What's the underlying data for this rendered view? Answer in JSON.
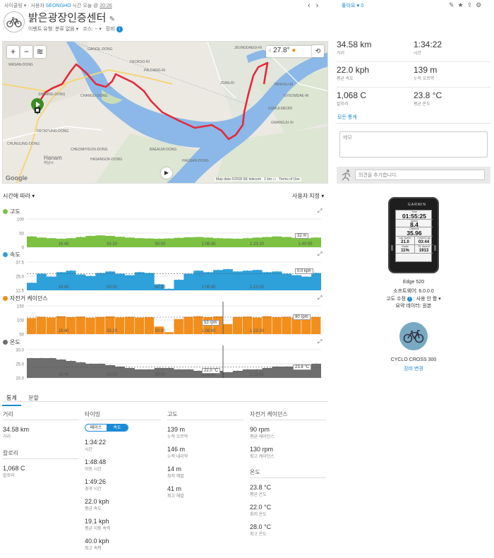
{
  "header": {
    "crumb_activity": "사이클링",
    "crumb_user_label": "사용자",
    "crumb_user": "SEONGHO",
    "crumb_time_label": "시간",
    "crumb_time_date": "오늘 @",
    "crumb_time": "20:26",
    "title": "밝은광장인증센터",
    "event_type": "이벤트 유형: 분류 없음 ▾",
    "course": "코스: -- ▾",
    "gear": "장비",
    "like": "좋아요",
    "like_count": "0"
  },
  "map": {
    "temperature": "27.8°",
    "attribution": "Map data ©2018 SK telecom",
    "scale": "1 km",
    "terms": "Terms of Use",
    "google": "Google",
    "places": [
      "WASAN-DONG",
      "GANGIL-DONG",
      "PALDANG-RI",
      "DEOKSO-RI",
      "JOAN-RI",
      "SINJANG-DONG",
      "CHANGU-DONG",
      "Hanam",
      "하남시",
      "CHUNGUNG-DONG",
      "DEOKPUNG-DONG",
      "CHEONHYEON-DONG",
      "HASANGOK-DONG",
      "BAEALMI-DONG",
      "HAGSAN-DONG",
      "JEUNGDAEGI-RI",
      "YANGSU-RI",
      "GYEOMDAE-RI",
      "DUMULMEORI",
      "GWANGJU-SI"
    ]
  },
  "chart_controls": {
    "left": "시간에 따라 ▾",
    "right": "사용자 지정 ▾"
  },
  "colors": {
    "elevation": "#7cc142",
    "speed": "#2ea0da",
    "cadence": "#f28e1c",
    "temperature": "#6e6e6e",
    "route": "#e4293c",
    "accent": "#1a8bd6"
  },
  "chart_data": [
    {
      "type": "area",
      "title": "고도",
      "color_key": "elevation",
      "ylim": [
        0,
        100
      ],
      "yticks": [
        "100",
        "50",
        "0"
      ],
      "xticks": [
        "16:40",
        "33:20",
        "50:00",
        "1:06:40",
        "1:23:20",
        "1:40:00"
      ],
      "readout": "32 m",
      "x_minutes": [
        0,
        4,
        8,
        12,
        16,
        20,
        24,
        28,
        32,
        36,
        40,
        44,
        48,
        52,
        56,
        60,
        64,
        68,
        72,
        76,
        80,
        84,
        88,
        92,
        96,
        100,
        104,
        108,
        112,
        116
      ],
      "values": [
        38,
        34,
        32,
        30,
        32,
        36,
        40,
        42,
        40,
        37,
        34,
        32,
        31,
        30,
        31,
        33,
        35,
        36,
        34,
        32,
        31,
        30,
        32,
        34,
        36,
        38,
        36,
        33,
        32,
        34
      ]
    },
    {
      "type": "area",
      "title": "속도",
      "color_key": "speed",
      "ylim": [
        0,
        37.5
      ],
      "yticks": [
        "37.5",
        "25.0",
        "12.5"
      ],
      "xticks": [
        "16:40",
        "33:20",
        "50:00",
        "1:06:40",
        "1:23:20"
      ],
      "readout": "0.0 kph",
      "avg_line": 22.0,
      "x_minutes": [
        0,
        4,
        8,
        12,
        16,
        20,
        24,
        28,
        32,
        36,
        40,
        44,
        48,
        52,
        56,
        60,
        64,
        68,
        72,
        76,
        80,
        84,
        88,
        92,
        96,
        100,
        104,
        108,
        112,
        116
      ],
      "values": [
        10,
        22,
        18,
        24,
        26,
        21,
        19,
        23,
        25,
        22,
        20,
        24,
        23,
        8,
        2,
        14,
        22,
        26,
        24,
        27,
        28,
        25,
        26,
        27,
        24,
        25,
        22,
        20,
        18,
        23
      ]
    },
    {
      "type": "bar",
      "title": "자전거 케이던스",
      "color_key": "cadence",
      "ylim": [
        0,
        150
      ],
      "yticks": [
        "150",
        "100",
        "50"
      ],
      "xticks": [
        "16:40",
        "33:20",
        "50:00",
        "1:06:40",
        "1:23:20"
      ],
      "readout": "53 rpm",
      "readout2": "90 rpm",
      "cursor_minute": 80,
      "avg_line": 90,
      "x_minutes": [
        0,
        4,
        8,
        12,
        16,
        20,
        24,
        28,
        32,
        36,
        40,
        44,
        48,
        52,
        56,
        60,
        64,
        68,
        72,
        76,
        80,
        84,
        88,
        92,
        96,
        100,
        104,
        108,
        112,
        116
      ],
      "values": [
        85,
        92,
        88,
        95,
        90,
        93,
        87,
        91,
        94,
        89,
        92,
        88,
        90,
        40,
        10,
        80,
        92,
        95,
        90,
        94,
        53,
        91,
        93,
        88,
        95,
        90,
        92,
        87,
        90,
        91
      ]
    },
    {
      "type": "area",
      "title": "온도",
      "color_key": "temperature",
      "ylim": [
        20.0,
        30.0
      ],
      "yticks": [
        "30.0",
        "25.0",
        "20.0"
      ],
      "xticks": [
        "16:40",
        "33:20",
        "50:00",
        "1:06:40",
        "1:23:20"
      ],
      "readout": "22.0 °C",
      "readout2": "23.8 °C",
      "cursor_minute": 80,
      "avg_line": 23.8,
      "x_minutes": [
        0,
        4,
        8,
        12,
        16,
        20,
        24,
        28,
        32,
        36,
        40,
        44,
        48,
        52,
        56,
        60,
        64,
        68,
        72,
        76,
        80,
        84,
        88,
        92,
        96,
        100,
        104,
        108,
        112,
        116
      ],
      "values": [
        27,
        27,
        27,
        26.5,
        26,
        25.5,
        25,
        25,
        24.5,
        24,
        23.5,
        23,
        23,
        23.5,
        23.5,
        23,
        23,
        22.5,
        22.5,
        22.5,
        22,
        22.5,
        23,
        23,
        23.5,
        24,
        24,
        24,
        24.5,
        25
      ]
    }
  ],
  "tabs": [
    "통계",
    "분할"
  ],
  "stats": {
    "distance": {
      "head": "거리",
      "value": "34.58 km",
      "label": "거리"
    },
    "calories": {
      "head": "칼로리",
      "value": "1,068 C",
      "label": "칼로리"
    },
    "timing": {
      "head": "타이밍",
      "toggle_a": "페이스",
      "toggle_b": "속도",
      "rows": [
        {
          "value": "1:34:22",
          "label": "시간"
        },
        {
          "value": "1:48:48",
          "label": "이동 시간"
        },
        {
          "value": "1:49:26",
          "label": "경과 시간"
        },
        {
          "value": "22.0 kph",
          "label": "평균 속도"
        },
        {
          "value": "19.1 kph",
          "label": "평균 이동 속력"
        },
        {
          "value": "40.0 kph",
          "label": "최고 속력"
        }
      ]
    },
    "elevation": {
      "head": "고도",
      "rows": [
        {
          "value": "139 m",
          "label": "누적 오르막"
        },
        {
          "value": "146 m",
          "label": "누적 내리막"
        },
        {
          "value": "14 m",
          "label": "최저 해발"
        },
        {
          "value": "41 m",
          "label": "최고 해발"
        }
      ]
    },
    "cadence": {
      "head": "자전거 케이던스",
      "rows": [
        {
          "value": "90 rpm",
          "label": "평균 케이던스"
        },
        {
          "value": "130 rpm",
          "label": "최고 케이던스"
        }
      ]
    },
    "temperature": {
      "head": "온도",
      "rows": [
        {
          "value": "23.8 °C",
          "label": "평균 온도"
        },
        {
          "value": "22.0 °C",
          "label": "최저 온도"
        },
        {
          "value": "28.0 °C",
          "label": "최고 온도"
        }
      ]
    }
  },
  "summary": {
    "items": [
      {
        "value": "34.58 km",
        "label": "거리"
      },
      {
        "value": "1:34:22",
        "label": "시간"
      },
      {
        "value": "22.0 kph",
        "label": "평균 속도"
      },
      {
        "value": "139 m",
        "label": "누적 오르막"
      },
      {
        "value": "1,068 C",
        "label": "칼로리"
      },
      {
        "value": "23.8 °C",
        "label": "평균 온도"
      }
    ],
    "all_stats": "모든 통계"
  },
  "notes": {
    "placeholder": "메모"
  },
  "comment": {
    "placeholder": "의견을 추가합니다."
  },
  "device": {
    "brand": "GARMIN",
    "screen": [
      {
        "label": "Time",
        "value": "01:55:25"
      },
      {
        "label": "Speed",
        "value": "8.4"
      },
      {
        "label": "Distance",
        "value": "35.96"
      },
      {
        "label": "Lap Speed",
        "value": "21.0"
      },
      {
        "label": "Current Lap",
        "value": "03:44"
      },
      {
        "label": "Grade",
        "value": "11%"
      },
      {
        "label": "Ttl. Ascent",
        "value": "1913"
      }
    ],
    "name": "Edge 520",
    "firmware": "소프트웨어: 6.0.0.0",
    "altitude_fix": "고도 수정",
    "altitude_fix_value": ": 사용 안 함 ▾",
    "summary_data": "요약 데이터: 원본"
  },
  "bike": {
    "name": "CYCLO CROSS 300",
    "change": "장비 변경"
  }
}
